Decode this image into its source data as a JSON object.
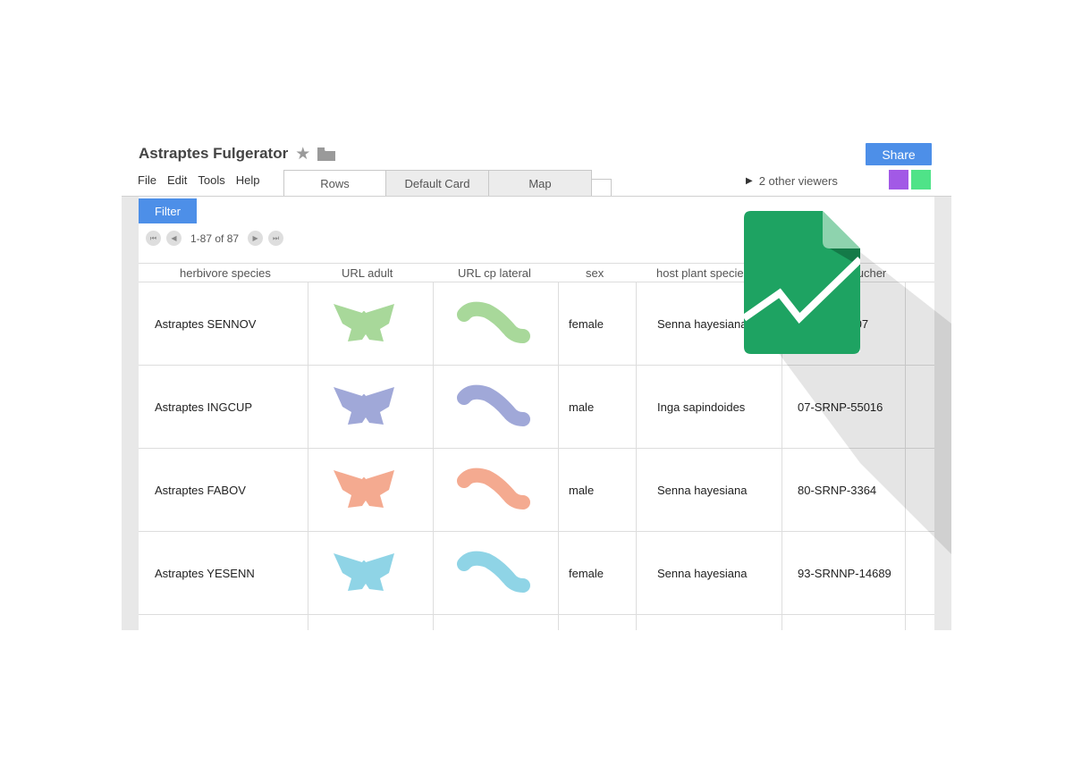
{
  "document": {
    "title": "Astraptes Fulgerator"
  },
  "menu": [
    "File",
    "Edit",
    "Tools",
    "Help"
  ],
  "tabs": [
    "Rows",
    "Default Card",
    "Map"
  ],
  "share_label": "Share",
  "viewers_text": "2 other viewers",
  "viewer_colors": [
    "#a259e6",
    "#4fe388"
  ],
  "filter_label": "Filter",
  "pager_text": "1-87 of 87",
  "columns": [
    "herbivore species",
    "URL adult",
    "URL cp lateral",
    "sex",
    "host plant species",
    "voucher"
  ],
  "rows": [
    {
      "species": "Astraptes SENNOV",
      "color": "#a8d89a",
      "sex": "female",
      "host": "Senna hayesiana",
      "voucher": "..9407"
    },
    {
      "species": "Astraptes INGCUP",
      "color": "#a0a8d8",
      "sex": "male",
      "host": "Inga sapindoides",
      "voucher": "07-SRNP-55016"
    },
    {
      "species": "Astraptes FABOV",
      "color": "#f4aa90",
      "sex": "male",
      "host": "Senna hayesiana",
      "voucher": "80-SRNP-3364"
    },
    {
      "species": "Astraptes YESENN",
      "color": "#8fd4e6",
      "sex": "female",
      "host": "Senna hayesiana",
      "voucher": "93-SRNNP-14689"
    }
  ],
  "icons": {
    "star": "star-icon",
    "folder": "folder-icon",
    "logo": "google-sheets-logo-icon",
    "pager": [
      "first-page-icon",
      "previous-page-icon",
      "next-page-icon",
      "last-page-icon"
    ]
  },
  "colors": {
    "accent": "#4d8fe8",
    "logo_green": "#1ea362",
    "logo_fold": "#8ed3ae"
  }
}
